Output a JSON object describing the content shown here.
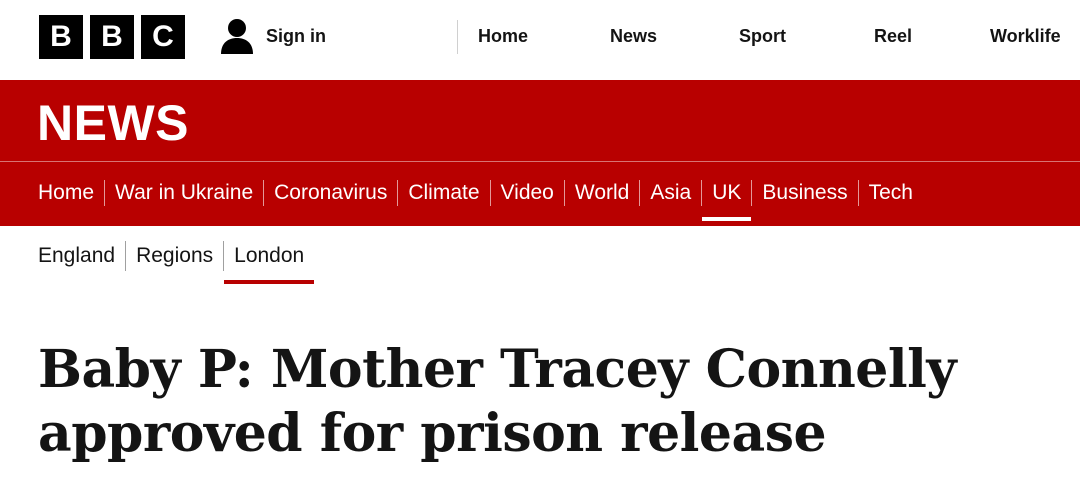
{
  "header": {
    "logo_letters": [
      "B",
      "B",
      "C"
    ],
    "sign_in": {
      "label": "Sign in",
      "icon": "person-icon"
    },
    "top_nav": [
      "Home",
      "News",
      "Sport",
      "Reel",
      "Worklife"
    ]
  },
  "news_banner": {
    "title": "NEWS",
    "section_nav": [
      "Home",
      "War in Ukraine",
      "Coronavirus",
      "Climate",
      "Video",
      "World",
      "Asia",
      "UK",
      "Business",
      "Tech"
    ],
    "active_section": "UK"
  },
  "sub_nav": {
    "items": [
      "England",
      "Regions",
      "London"
    ],
    "active_item": "London"
  },
  "article": {
    "headline": "Baby P: Mother Tracey Connelly approved for prison release"
  },
  "colors": {
    "brand_red": "#b80000",
    "text": "#141414",
    "logo_black": "#000000"
  }
}
